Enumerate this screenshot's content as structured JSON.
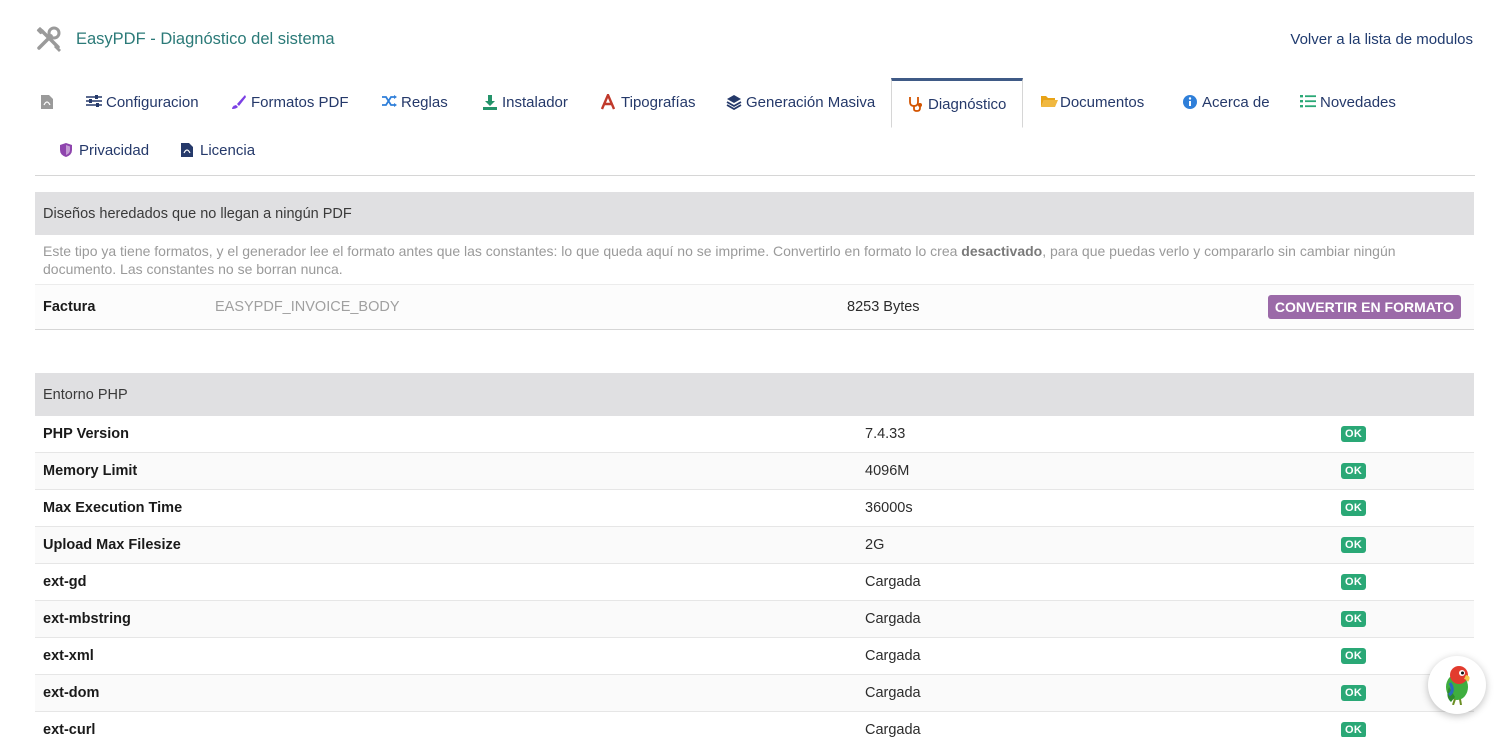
{
  "header": {
    "title": "EasyPDF - Diagnóstico del sistema",
    "back_link": "Volver a la lista de modulos",
    "icon": "tools-icon"
  },
  "tabs": [
    {
      "label": "",
      "icon": "pdf-file-icon",
      "color": "#9a9a9a"
    },
    {
      "label": "Configuracion",
      "icon": "sliders-icon",
      "color": "#25396a"
    },
    {
      "label": "Formatos PDF",
      "icon": "brush-icon",
      "color": "#7b3fe4"
    },
    {
      "label": "Reglas",
      "icon": "shuffle-icon",
      "color": "#2f7fd9"
    },
    {
      "label": "Instalador",
      "icon": "download-icon",
      "color": "#24936a"
    },
    {
      "label": "Tipografías",
      "icon": "font-icon",
      "color": "#c0392b"
    },
    {
      "label": "Generación Masiva",
      "icon": "layers-icon",
      "color": "#25396a"
    },
    {
      "label": "Diagnóstico",
      "icon": "stethoscope-icon",
      "color": "#d35400",
      "active": true
    },
    {
      "label": "Documentos",
      "icon": "folder-open-icon",
      "color": "#e8a317"
    },
    {
      "label": "Acerca de",
      "icon": "info-circle-icon",
      "color": "#2f7fd9"
    },
    {
      "label": "Novedades",
      "icon": "list-icon",
      "color": "#2aa876"
    },
    {
      "label": "Privacidad",
      "icon": "shield-icon",
      "color": "#8e44ad"
    },
    {
      "label": "Licencia",
      "icon": "file-icon",
      "color": "#25396a"
    }
  ],
  "legacy_panel": {
    "title": "Diseños heredados que no llegan a ningún PDF",
    "desc_before": "Este tipo ya tiene formatos, y el generador lee el formato antes que las constantes: lo que queda aquí no se imprime. Convertirlo en formato lo crea ",
    "desc_bold": "desactivado",
    "desc_after": ", para que puedas verlo y compararlo sin cambiar ningún documento. Las constantes no se borran nunca.",
    "row": {
      "name": "Factura",
      "constant": "EASYPDF_INVOICE_BODY",
      "size": "8253 Bytes",
      "button": "CONVERTIR EN FORMATO"
    }
  },
  "php_panel": {
    "title": "Entorno PHP",
    "rows": [
      {
        "key": "PHP Version",
        "value": "7.4.33",
        "status": "OK"
      },
      {
        "key": "Memory Limit",
        "value": "4096M",
        "status": "OK"
      },
      {
        "key": "Max Execution Time",
        "value": "36000s",
        "status": "OK"
      },
      {
        "key": "Upload Max Filesize",
        "value": "2G",
        "status": "OK"
      },
      {
        "key": "ext-gd",
        "value": "Cargada",
        "status": "OK"
      },
      {
        "key": "ext-mbstring",
        "value": "Cargada",
        "status": "OK"
      },
      {
        "key": "ext-xml",
        "value": "Cargada",
        "status": "OK"
      },
      {
        "key": "ext-dom",
        "value": "Cargada",
        "status": "OK"
      },
      {
        "key": "ext-curl",
        "value": "Cargada",
        "status": "OK"
      }
    ]
  },
  "assistant": {
    "icon": "parrot-icon"
  }
}
